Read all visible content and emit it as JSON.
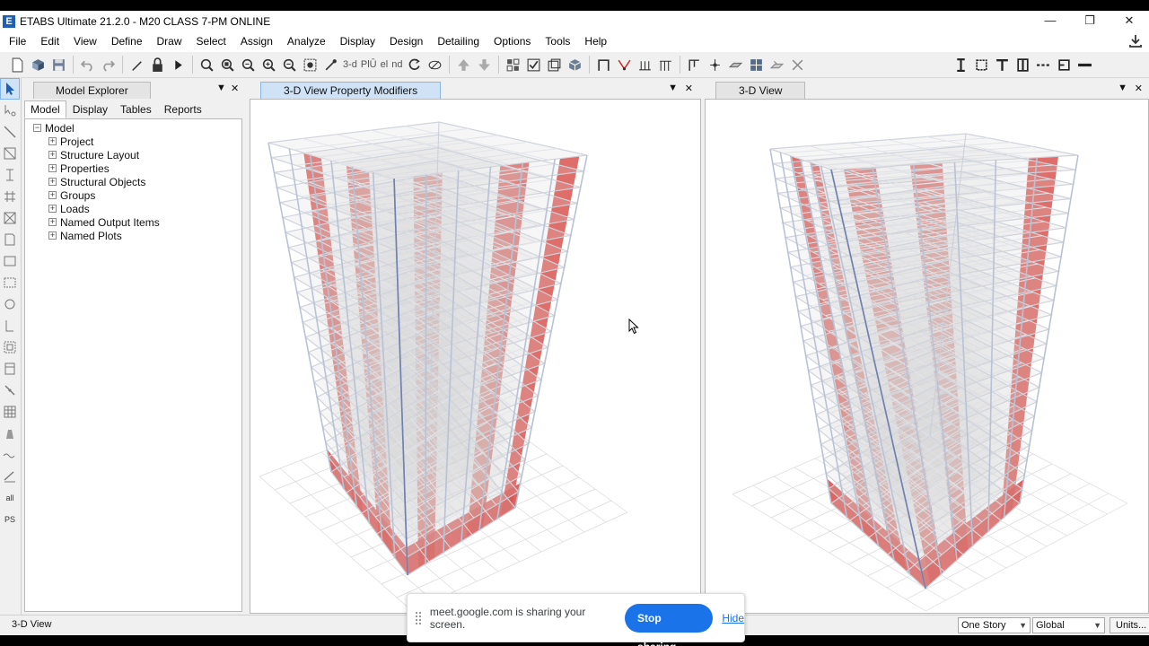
{
  "window": {
    "title": "ETABS Ultimate 21.2.0 - M20 CLASS 7-PM ONLINE",
    "controls": [
      "—",
      "❐",
      "✕"
    ]
  },
  "menu": [
    "File",
    "Edit",
    "View",
    "Define",
    "Draw",
    "Select",
    "Assign",
    "Analyze",
    "Display",
    "Design",
    "Detailing",
    "Options",
    "Tools",
    "Help"
  ],
  "toolbar": {
    "text_3d": "3-d",
    "text_pl": "PlÛ",
    "text_el": "el",
    "text_nd": "nd"
  },
  "explorer": {
    "title": "Model Explorer",
    "tabs": [
      "Model",
      "Display",
      "Tables",
      "Reports"
    ],
    "active_tab": "Model",
    "root": "Model",
    "items": [
      "Project",
      "Structure Layout",
      "Properties",
      "Structural Objects",
      "Groups",
      "Loads",
      "Named Output Items",
      "Named Plots"
    ]
  },
  "views": {
    "left": {
      "title": "3-D View  Property Modifiers"
    },
    "right": {
      "title": "3-D View"
    },
    "pane_controls": {
      "menu": "▼",
      "close": "✕"
    }
  },
  "status": {
    "text": "3-D View",
    "story": "One Story",
    "coord": "Global",
    "units": "Units..."
  },
  "share": {
    "message": "meet.google.com is sharing your screen.",
    "stop": "Stop sharing",
    "hide": "Hide"
  },
  "colors": {
    "wall": "#d9534f",
    "slab": "#d8d8d8",
    "frame": "#b8c2d6",
    "accent": "#1a73e8"
  },
  "lefttools": {
    "label_all": "all",
    "label_ps": "PS"
  }
}
